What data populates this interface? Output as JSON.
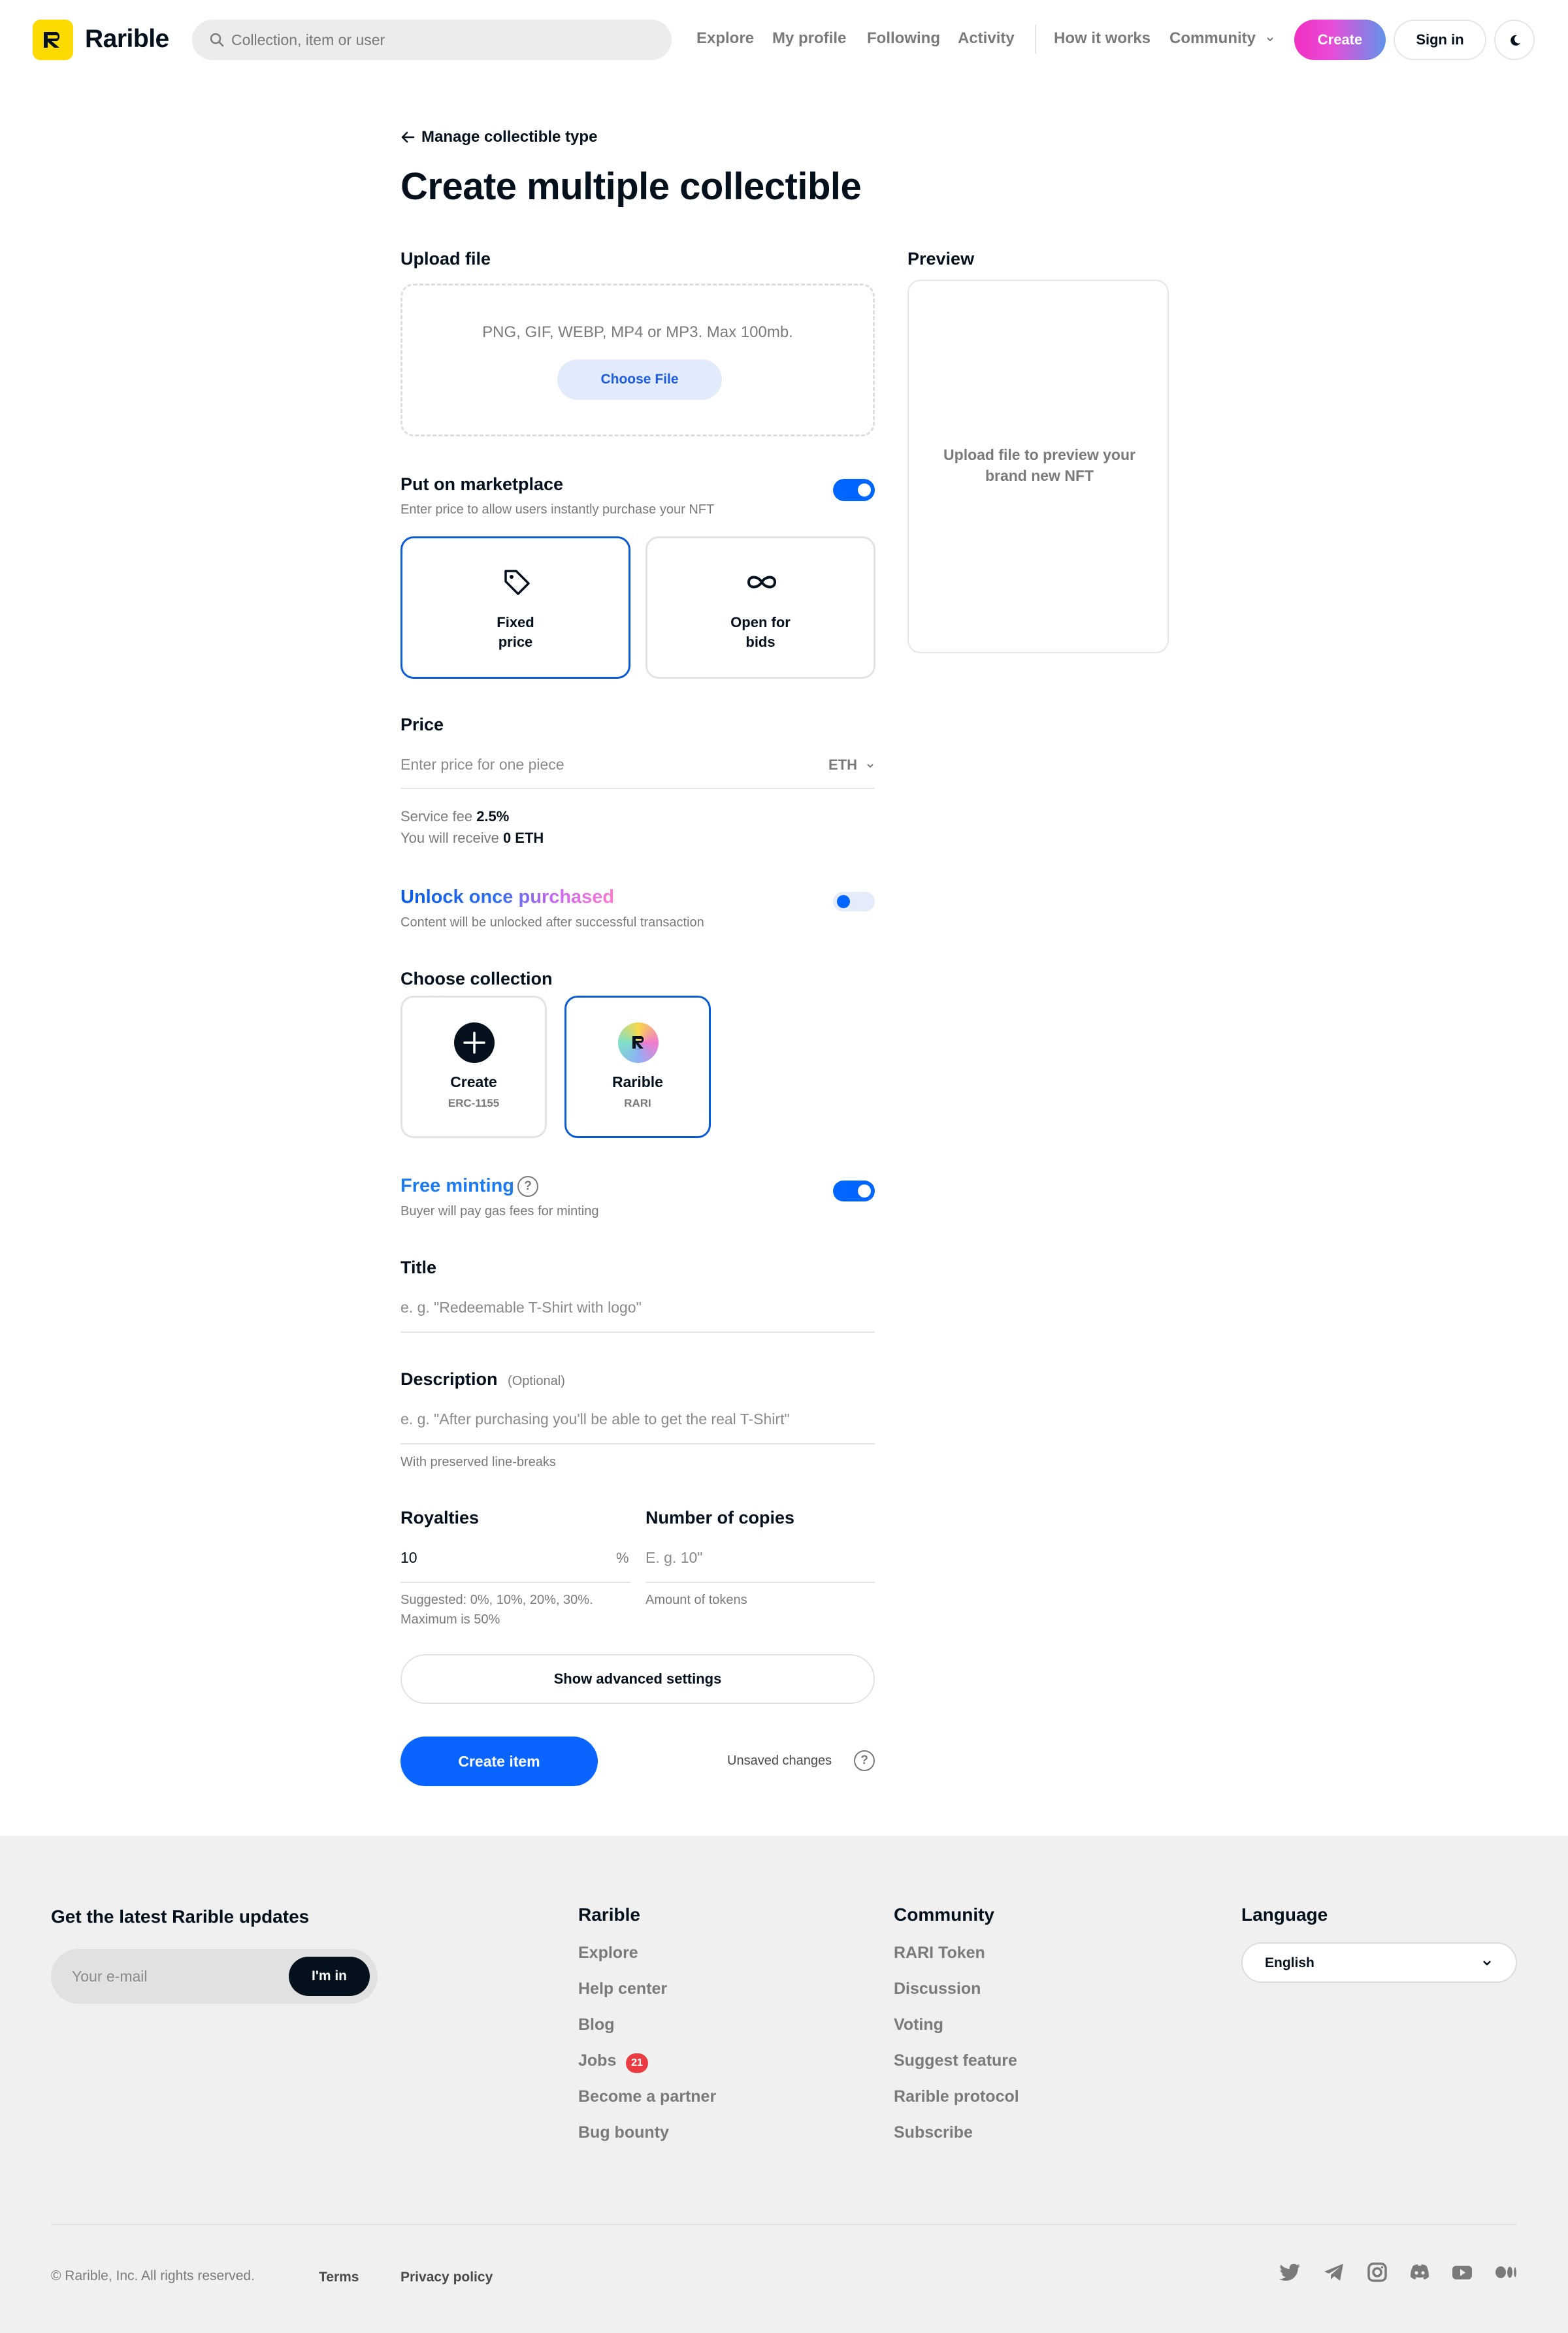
{
  "header": {
    "brand": "Rarible",
    "search_placeholder": "Collection, item or user",
    "nav": [
      "Explore",
      "My profile",
      "Following",
      "Activity",
      "How it works",
      "Community"
    ],
    "create_label": "Create",
    "signin_label": "Sign in"
  },
  "form": {
    "back_label": "Manage collectible type",
    "title": "Create multiple collectible",
    "upload": {
      "label": "Upload file",
      "hint": "PNG, GIF, WEBP, MP4 or MP3. Max 100mb.",
      "button": "Choose File"
    },
    "preview": {
      "label": "Preview",
      "text": "Upload file to preview your brand new NFT"
    },
    "marketplace": {
      "label": "Put on marketplace",
      "sub": "Enter price to allow users instantly purchase your NFT",
      "enabled": true,
      "options": [
        {
          "line1": "Fixed",
          "line2": "price",
          "selected": true
        },
        {
          "line1": "Open for",
          "line2": "bids",
          "selected": false
        }
      ]
    },
    "price": {
      "label": "Price",
      "placeholder": "Enter price for one piece",
      "currency": "ETH",
      "fee_label": "Service fee",
      "fee_value": "2.5%",
      "receive_label": "You will receive",
      "receive_value": "0 ETH"
    },
    "unlock": {
      "label": "Unlock once purchased",
      "sub": "Content will be unlocked after successful transaction",
      "enabled": false
    },
    "collection": {
      "label": "Choose collection",
      "items": [
        {
          "name": "Create",
          "sub": "ERC-1155",
          "selected": false
        },
        {
          "name": "Rarible",
          "sub": "RARI",
          "selected": true
        }
      ]
    },
    "free_minting": {
      "label": "Free minting",
      "sub": "Buyer will pay gas fees for minting",
      "enabled": true,
      "help": "?"
    },
    "title_field": {
      "label": "Title",
      "placeholder": "e. g. \"Redeemable T-Shirt with logo\""
    },
    "description": {
      "label": "Description",
      "optional": "(Optional)",
      "placeholder": "e. g. \"After purchasing you'll be able to get the real T-Shirt\"",
      "hint": "With preserved line-breaks"
    },
    "royalties": {
      "label": "Royalties",
      "value": "10",
      "unit": "%",
      "hint_line1": "Suggested: 0%, 10%, 20%, 30%.",
      "hint_line2": "Maximum is 50%"
    },
    "copies": {
      "label": "Number of copies",
      "placeholder": "E. g. 10\"",
      "hint": "Amount of tokens"
    },
    "advanced_label": "Show advanced settings",
    "create_label": "Create item",
    "unsaved_label": "Unsaved changes",
    "unsaved_help": "?"
  },
  "footer": {
    "updates_title": "Get the latest Rarible updates",
    "email_placeholder": "Your e-mail",
    "subscribe_label": "I'm in",
    "rarible_title": "Rarible",
    "rarible_links": [
      "Explore",
      "Help center",
      "Blog",
      "Jobs",
      "Become a partner",
      "Bug bounty"
    ],
    "jobs_badge": "21",
    "community_title": "Community",
    "community_links": [
      "RARI Token",
      "Discussion",
      "Voting",
      "Suggest feature",
      "Rarible protocol",
      "Subscribe"
    ],
    "language_title": "Language",
    "language_value": "English",
    "copyright": "© Rarible, Inc. All rights reserved.",
    "terms": "Terms",
    "privacy": "Privacy policy",
    "social_icons": [
      "twitter-icon",
      "telegram-icon",
      "instagram-icon",
      "discord-icon",
      "youtube-icon",
      "medium-icon"
    ]
  },
  "colors": {
    "brand_yellow": "#feda03",
    "primary_blue": "#0066ff",
    "create_gradient_start": "#f02fc2",
    "create_gradient_end": "#6094ea",
    "badge_red": "#eb3b42"
  }
}
